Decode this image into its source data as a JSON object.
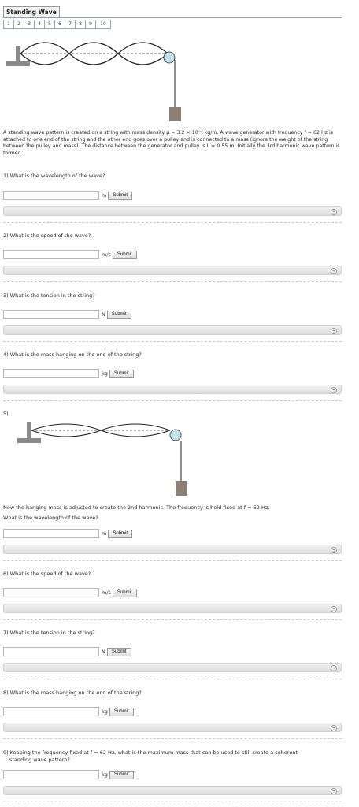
{
  "header": {
    "title": "Standing Wave",
    "tabs": [
      "1",
      "2",
      "3",
      "4",
      "5",
      "6",
      "7",
      "8",
      "9",
      "10"
    ]
  },
  "intro": "A standing wave pattern is created on a string with mass density μ = 3.2 × 10⁻⁴ kg/m. A wave generator with frequency f = 62 Hz is attached to one end of the string and the other end goes over a pulley and is connected to a mass (ignore the weight of the string between the pulley and mass). The distance between the generator and pulley is L = 0.55 m. Initially the 3rd harmonic wave pattern is formed.",
  "submit_label": "Submit",
  "q1": {
    "text": "1) What is the wavelength of the wave?",
    "unit": "m"
  },
  "q2": {
    "text": "2) What is the speed of the wave?",
    "unit": "m/s"
  },
  "q3": {
    "text": "3) What is the tension in the string?",
    "unit": "N"
  },
  "q4": {
    "text": "4) What is the mass hanging on the end of the string?",
    "unit": "kg"
  },
  "q5": {
    "num": "5)",
    "text1": "Now the hanging mass is adjusted to create the 2nd harmonic. The frequency is held fixed at f = 62 Hz.",
    "text2": "What is the wavelength of the wave?",
    "unit": "m"
  },
  "q6": {
    "text": "6) What is the speed of the wave?",
    "unit": "m/s"
  },
  "q7": {
    "text": "7) What is the tension in the string?",
    "unit": "N"
  },
  "q8": {
    "text": "8) What is the mass hanging on the end of the string?",
    "unit": "kg"
  },
  "q9": {
    "text1": "9) Keeping the frequency fixed at f = 62 Hz, what is the maximum mass that can be used to still create a coherent",
    "text2": "standing wave pattern?",
    "unit": "kg"
  },
  "hint_icon": "plus-icon",
  "colors": {
    "pulley": "#bfe0e6",
    "mass": "#8d7f74",
    "generator": "#8a8a8a"
  }
}
